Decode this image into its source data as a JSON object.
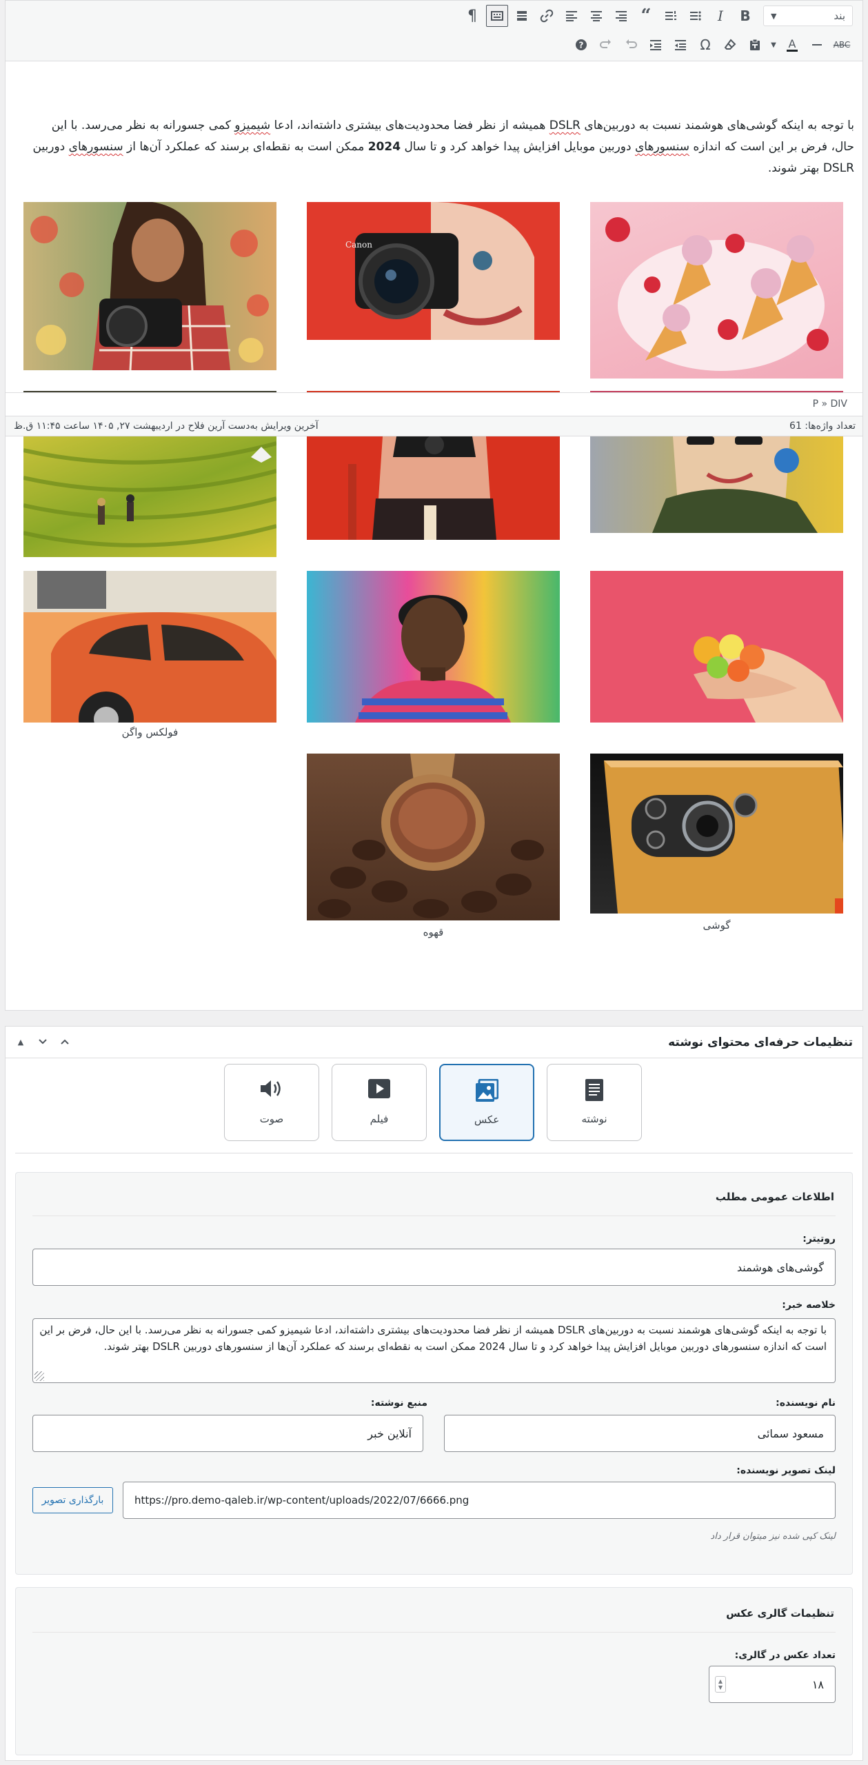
{
  "toolbar": {
    "format_select": "بند",
    "row1": [
      "bold",
      "italic",
      "bullet-list",
      "numbered-list",
      "blockquote",
      "align-right",
      "align-center",
      "align-left",
      "link",
      "read-more",
      "toolbar-toggle",
      "paragraph-mark"
    ],
    "row2": [
      "strikethrough",
      "horizontal-line",
      "text-color",
      "paste-as-text",
      "clear-formatting",
      "special-character",
      "outdent",
      "indent",
      "undo",
      "redo",
      "help"
    ]
  },
  "editor": {
    "para_1": "با توجه به اینکه گوشی‌های هوشمند نسبت به دوربین‌های ",
    "para_dslr": "DSLR",
    "para_2": " همیشه از نظر فضا محدودیت‌های بیشتری داشته‌اند، ادعا ",
    "para_sp1": "شیمیزو",
    "para_3": " کمی جسورانه به نظر می‌رسد. با این حال، فرض بر این است که اندازه ",
    "para_sp2": "سنسورهای",
    "para_4": " دوربین موبایل افزایش پیدا خواهد کرد و تا سال ",
    "para_year": "2024",
    "para_5": " ممکن است به نقطه‌ای برسند که عملکرد آن‌ها از ",
    "para_sp3": "سنسورهای",
    "para_6": " دوربین DSLR بهتر شوند.",
    "path": "P » DIV",
    "word_count": "تعداد واژه‌ها: 61",
    "last_edit": "آخرین ویرایش به‌دست آرین فلاح در اردیبهشت ۲۷, ۱۴۰۵ ساعت ۱۱:۴۵ ق.ظ",
    "caption_car": "فولکس واگن",
    "caption_coffee": "قهوه",
    "caption_phone": "گوشی"
  },
  "metabox": {
    "title": "تنظیمات حرفه‌ای محتوای نوشته",
    "formats": [
      {
        "label": "نوشته",
        "icon": "document-icon"
      },
      {
        "label": "عکس",
        "icon": "image-icon"
      },
      {
        "label": "فیلم",
        "icon": "video-icon"
      },
      {
        "label": "صوت",
        "icon": "audio-icon"
      }
    ],
    "selected_format": "عکس",
    "general_title": "اطلاعات عمومی مطلب",
    "rotitr_label": "روتیتر:",
    "rotitr_value": "گوشی‌های هوشمند",
    "summary_label": "خلاصه خبر:",
    "summary_value": "با توجه به اینکه گوشی‌های هوشمند نسبت به دوربین‌های DSLR همیشه از نظر فضا محدودیت‌های بیشتری داشته‌اند، ادعا شیمیزو کمی جسورانه به نظر می‌رسد. با این حال، فرض بر این است که اندازه سنسورهای دوربین موبایل افزایش پیدا خواهد کرد و تا سال 2024 ممکن است به نقطه‌ای برسند که عملکرد آن‌ها از سنسورهای دوربین DSLR بهتر شوند.",
    "author_label": "نام نویسنده:",
    "author_value": "مسعود سمائی",
    "source_label": "منبع نوشته:",
    "source_value": "آنلاین خبر",
    "author_img_label": "لینک تصویر نویسنده:",
    "author_img_value": "https://pro.demo-qaleb.ir/wp-content/uploads/2022/07/6666.png",
    "upload_button": "بارگذاری تصویر",
    "author_img_hint": "لینک کپی شده نیز میتوان قرار داد",
    "gallery_title": "تنظیمات گالری عکس",
    "gallery_count_label": "تعداد عکس در گالری:",
    "gallery_count_value": "۱۸"
  },
  "colors": {
    "accent": "#2271b1",
    "spellcheck": "#d63638",
    "border": "#dcdcde"
  }
}
